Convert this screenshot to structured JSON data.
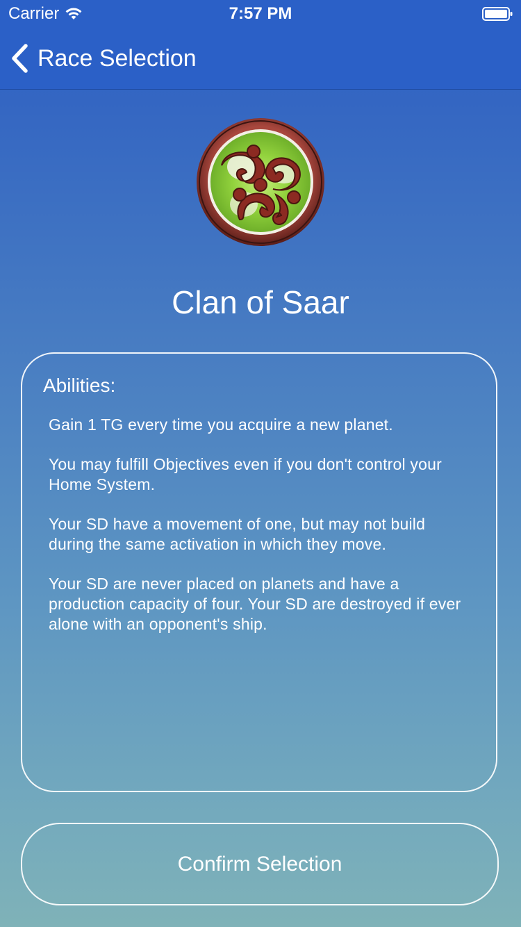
{
  "status_bar": {
    "carrier": "Carrier",
    "time": "7:57 PM",
    "icons": [
      "wifi-icon",
      "battery-icon"
    ]
  },
  "nav": {
    "back_label": "Race Selection",
    "back_icon": "chevron-left-icon"
  },
  "race": {
    "emblem_icon": "race-emblem-icon",
    "name": "Clan of Saar"
  },
  "abilities": {
    "heading": "Abilities:",
    "items": [
      "Gain 1 TG every time you acquire a new planet.",
      "You may fulfill Objectives even if you don't control your Home System.",
      "Your SD have a movement of one, but may not build during the same activation in which they move.",
      "Your SD are never placed on planets and have a production capacity of four. Your SD are destroyed if ever alone with an opponent's ship."
    ]
  },
  "actions": {
    "confirm_label": "Confirm Selection"
  },
  "colors": {
    "nav_background": "#2b60c7",
    "gradient_top": "#2b5fc6",
    "gradient_bottom": "#7fb2b8",
    "text": "#ffffff",
    "emblem_green": "#8fd13a",
    "emblem_red": "#8c2a22"
  }
}
